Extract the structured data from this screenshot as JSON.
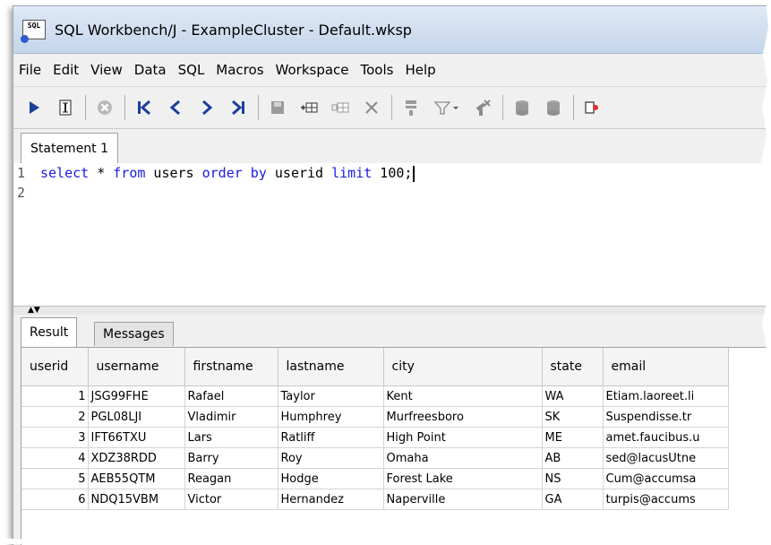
{
  "window": {
    "app_icon_text": "SQL",
    "title": "SQL Workbench/J - ExampleCluster - Default.wksp"
  },
  "menu": [
    "File",
    "Edit",
    "View",
    "Data",
    "SQL",
    "Macros",
    "Workspace",
    "Tools",
    "Help"
  ],
  "toolbar": [
    {
      "name": "execute-icon"
    },
    {
      "name": "execute-current-icon"
    },
    {
      "name": "stop-icon"
    },
    {
      "name": "first-record-icon"
    },
    {
      "name": "previous-record-icon"
    },
    {
      "name": "next-record-icon"
    },
    {
      "name": "last-record-icon"
    },
    {
      "name": "save-icon"
    },
    {
      "name": "insert-row-icon"
    },
    {
      "name": "copy-row-icon"
    },
    {
      "name": "delete-row-icon"
    },
    {
      "name": "filter-icon"
    },
    {
      "name": "filter-dropdown-icon"
    },
    {
      "name": "remove-filter-icon"
    },
    {
      "name": "commit-icon"
    },
    {
      "name": "rollback-icon"
    },
    {
      "name": "disconnect-icon"
    }
  ],
  "editor": {
    "tab_label": "Statement 1",
    "line_numbers": [
      "1",
      "2"
    ],
    "sql": {
      "kw1": "select",
      "t1": " * ",
      "kw2": "from",
      "t2": " users ",
      "kw3": "order by",
      "t3": " userid ",
      "kw4": "limit",
      "t4": " 100;"
    }
  },
  "results": {
    "tabs": {
      "result": "Result",
      "messages": "Messages"
    },
    "columns": [
      "userid",
      "username",
      "firstname",
      "lastname",
      "city",
      "state",
      "email"
    ],
    "rows": [
      [
        "1",
        "JSG99FHE",
        "Rafael",
        "Taylor",
        "Kent",
        "WA",
        "Etiam.laoreet.li"
      ],
      [
        "2",
        "PGL08LJI",
        "Vladimir",
        "Humphrey",
        "Murfreesboro",
        "SK",
        "Suspendisse.tr"
      ],
      [
        "3",
        "IFT66TXU",
        "Lars",
        "Ratliff",
        "High Point",
        "ME",
        "amet.faucibus.u"
      ],
      [
        "4",
        "XDZ38RDD",
        "Barry",
        "Roy",
        "Omaha",
        "AB",
        "sed@lacusUtne"
      ],
      [
        "5",
        "AEB55QTM",
        "Reagan",
        "Hodge",
        "Forest Lake",
        "NS",
        "Cum@accumsa"
      ],
      [
        "6",
        "NDQ15VBM",
        "Victor",
        "Hernandez",
        "Naperville",
        "GA",
        "turpis@accums"
      ]
    ]
  }
}
